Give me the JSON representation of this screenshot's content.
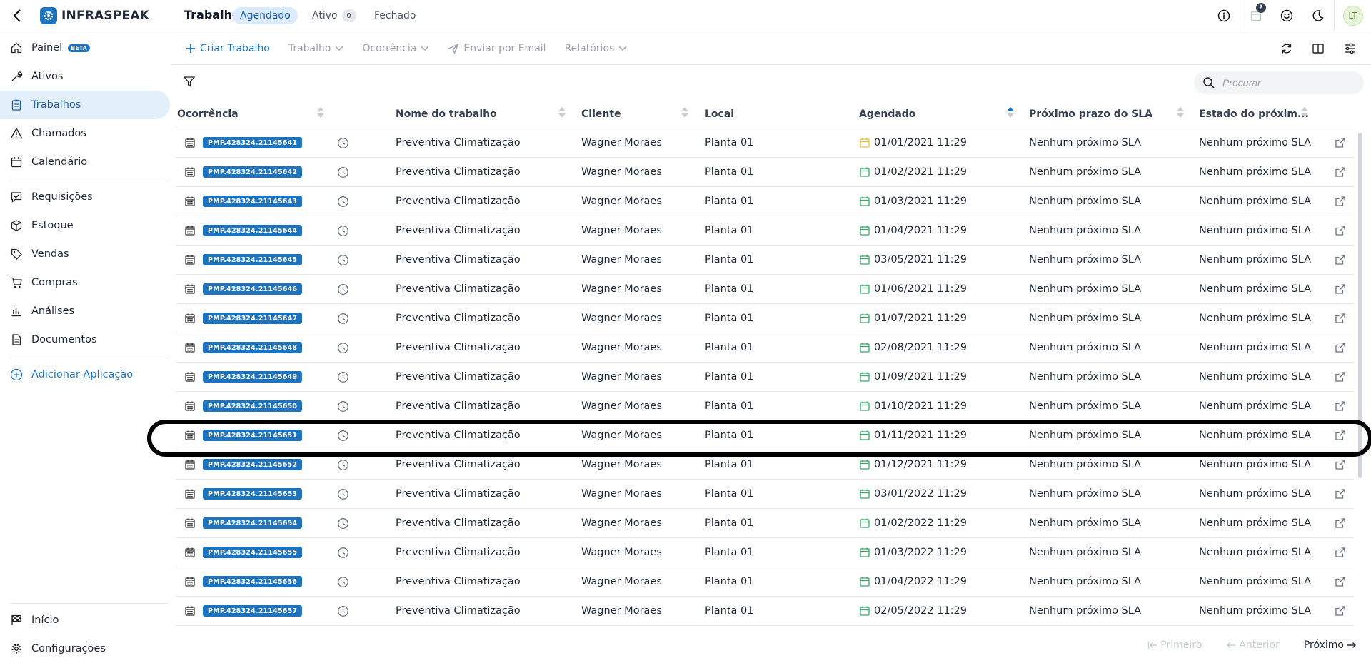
{
  "app": {
    "logo_text": "INFRASPEAK",
    "page_title": "Trabalhos",
    "state_tabs": [
      {
        "label": "Agendado",
        "active": true
      },
      {
        "label": "Ativo",
        "count": "0"
      },
      {
        "label": "Fechado"
      }
    ],
    "notification_count": "?",
    "avatar_initials": "LT",
    "accent_color": "#1e73be"
  },
  "sidebar": {
    "items": [
      {
        "label": "Painel",
        "badge": "BETA",
        "icon": "home-icon"
      },
      {
        "label": "Ativos",
        "icon": "wrench-icon"
      },
      {
        "label": "Trabalhos",
        "icon": "clipboard-icon",
        "active": true
      },
      {
        "label": "Chamados",
        "icon": "warning-icon"
      },
      {
        "label": "Calendário",
        "icon": "calendar-icon"
      },
      {
        "label": "Requisições",
        "icon": "check-message-icon"
      },
      {
        "label": "Estoque",
        "icon": "boxes-icon"
      },
      {
        "label": "Vendas",
        "icon": "tag-icon"
      },
      {
        "label": "Compras",
        "icon": "cart-icon"
      },
      {
        "label": "Análises",
        "icon": "bar-chart-icon"
      },
      {
        "label": "Documentos",
        "icon": "document-icon"
      }
    ],
    "add_app_label": "Adicionar Aplicação",
    "bottom_items": [
      {
        "label": "Início",
        "icon": "flag-icon"
      },
      {
        "label": "Configurações",
        "icon": "gear-icon"
      }
    ]
  },
  "toolbar": {
    "create_label": "Criar Trabalho",
    "job_label": "Trabalho",
    "occurrence_label": "Ocorrência",
    "email_label": "Enviar por Email",
    "reports_label": "Relatórios"
  },
  "search": {
    "placeholder": "Procurar"
  },
  "table": {
    "columns": [
      "Ocorrência",
      "Nome do trabalho",
      "Cliente",
      "Local",
      "Agendado",
      "Próximo prazo do SLA",
      "Estado do próxim..."
    ],
    "rows": [
      {
        "code": "PMP.428324.21145641",
        "name": "Preventiva Climatização",
        "client": "Wagner Moraes",
        "local": "Planta 01",
        "date": "01/01/2021 11:29",
        "sla": "Nenhum próximo SLA",
        "state": "Nenhum próximo SLA",
        "date_icon_color": "#e2c23a"
      },
      {
        "code": "PMP.428324.21145642",
        "name": "Preventiva Climatização",
        "client": "Wagner Moraes",
        "local": "Planta 01",
        "date": "01/02/2021 11:29",
        "sla": "Nenhum próximo SLA",
        "state": "Nenhum próximo SLA"
      },
      {
        "code": "PMP.428324.21145643",
        "name": "Preventiva Climatização",
        "client": "Wagner Moraes",
        "local": "Planta 01",
        "date": "01/03/2021 11:29",
        "sla": "Nenhum próximo SLA",
        "state": "Nenhum próximo SLA"
      },
      {
        "code": "PMP.428324.21145644",
        "name": "Preventiva Climatização",
        "client": "Wagner Moraes",
        "local": "Planta 01",
        "date": "01/04/2021 11:29",
        "sla": "Nenhum próximo SLA",
        "state": "Nenhum próximo SLA"
      },
      {
        "code": "PMP.428324.21145645",
        "name": "Preventiva Climatização",
        "client": "Wagner Moraes",
        "local": "Planta 01",
        "date": "03/05/2021 11:29",
        "sla": "Nenhum próximo SLA",
        "state": "Nenhum próximo SLA"
      },
      {
        "code": "PMP.428324.21145646",
        "name": "Preventiva Climatização",
        "client": "Wagner Moraes",
        "local": "Planta 01",
        "date": "01/06/2021 11:29",
        "sla": "Nenhum próximo SLA",
        "state": "Nenhum próximo SLA"
      },
      {
        "code": "PMP.428324.21145647",
        "name": "Preventiva Climatização",
        "client": "Wagner Moraes",
        "local": "Planta 01",
        "date": "01/07/2021 11:29",
        "sla": "Nenhum próximo SLA",
        "state": "Nenhum próximo SLA"
      },
      {
        "code": "PMP.428324.21145648",
        "name": "Preventiva Climatização",
        "client": "Wagner Moraes",
        "local": "Planta 01",
        "date": "02/08/2021 11:29",
        "sla": "Nenhum próximo SLA",
        "state": "Nenhum próximo SLA"
      },
      {
        "code": "PMP.428324.21145649",
        "name": "Preventiva Climatização",
        "client": "Wagner Moraes",
        "local": "Planta 01",
        "date": "01/09/2021 11:29",
        "sla": "Nenhum próximo SLA",
        "state": "Nenhum próximo SLA"
      },
      {
        "code": "PMP.428324.21145650",
        "name": "Preventiva Climatização",
        "client": "Wagner Moraes",
        "local": "Planta 01",
        "date": "01/10/2021 11:29",
        "sla": "Nenhum próximo SLA",
        "state": "Nenhum próximo SLA"
      },
      {
        "code": "PMP.428324.21145651",
        "name": "Preventiva Climatização",
        "client": "Wagner Moraes",
        "local": "Planta 01",
        "date": "01/11/2021 11:29",
        "sla": "Nenhum próximo SLA",
        "state": "Nenhum próximo SLA",
        "highlighted": true
      },
      {
        "code": "PMP.428324.21145652",
        "name": "Preventiva Climatização",
        "client": "Wagner Moraes",
        "local": "Planta 01",
        "date": "01/12/2021 11:29",
        "sla": "Nenhum próximo SLA",
        "state": "Nenhum próximo SLA"
      },
      {
        "code": "PMP.428324.21145653",
        "name": "Preventiva Climatização",
        "client": "Wagner Moraes",
        "local": "Planta 01",
        "date": "03/01/2022 11:29",
        "sla": "Nenhum próximo SLA",
        "state": "Nenhum próximo SLA"
      },
      {
        "code": "PMP.428324.21145654",
        "name": "Preventiva Climatização",
        "client": "Wagner Moraes",
        "local": "Planta 01",
        "date": "01/02/2022 11:29",
        "sla": "Nenhum próximo SLA",
        "state": "Nenhum próximo SLA"
      },
      {
        "code": "PMP.428324.21145655",
        "name": "Preventiva Climatização",
        "client": "Wagner Moraes",
        "local": "Planta 01",
        "date": "01/03/2022 11:29",
        "sla": "Nenhum próximo SLA",
        "state": "Nenhum próximo SLA"
      },
      {
        "code": "PMP.428324.21145656",
        "name": "Preventiva Climatização",
        "client": "Wagner Moraes",
        "local": "Planta 01",
        "date": "01/04/2022 11:29",
        "sla": "Nenhum próximo SLA",
        "state": "Nenhum próximo SLA"
      },
      {
        "code": "PMP.428324.21145657",
        "name": "Preventiva Climatização",
        "client": "Wagner Moraes",
        "local": "Planta 01",
        "date": "02/05/2022 11:29",
        "sla": "Nenhum próximo SLA",
        "state": "Nenhum próximo SLA"
      }
    ],
    "date_icon_color": "#3aa86b"
  },
  "pagination": {
    "first_label": "Primeiro",
    "prev_label": "Anterior",
    "next_label": "Próximo"
  }
}
